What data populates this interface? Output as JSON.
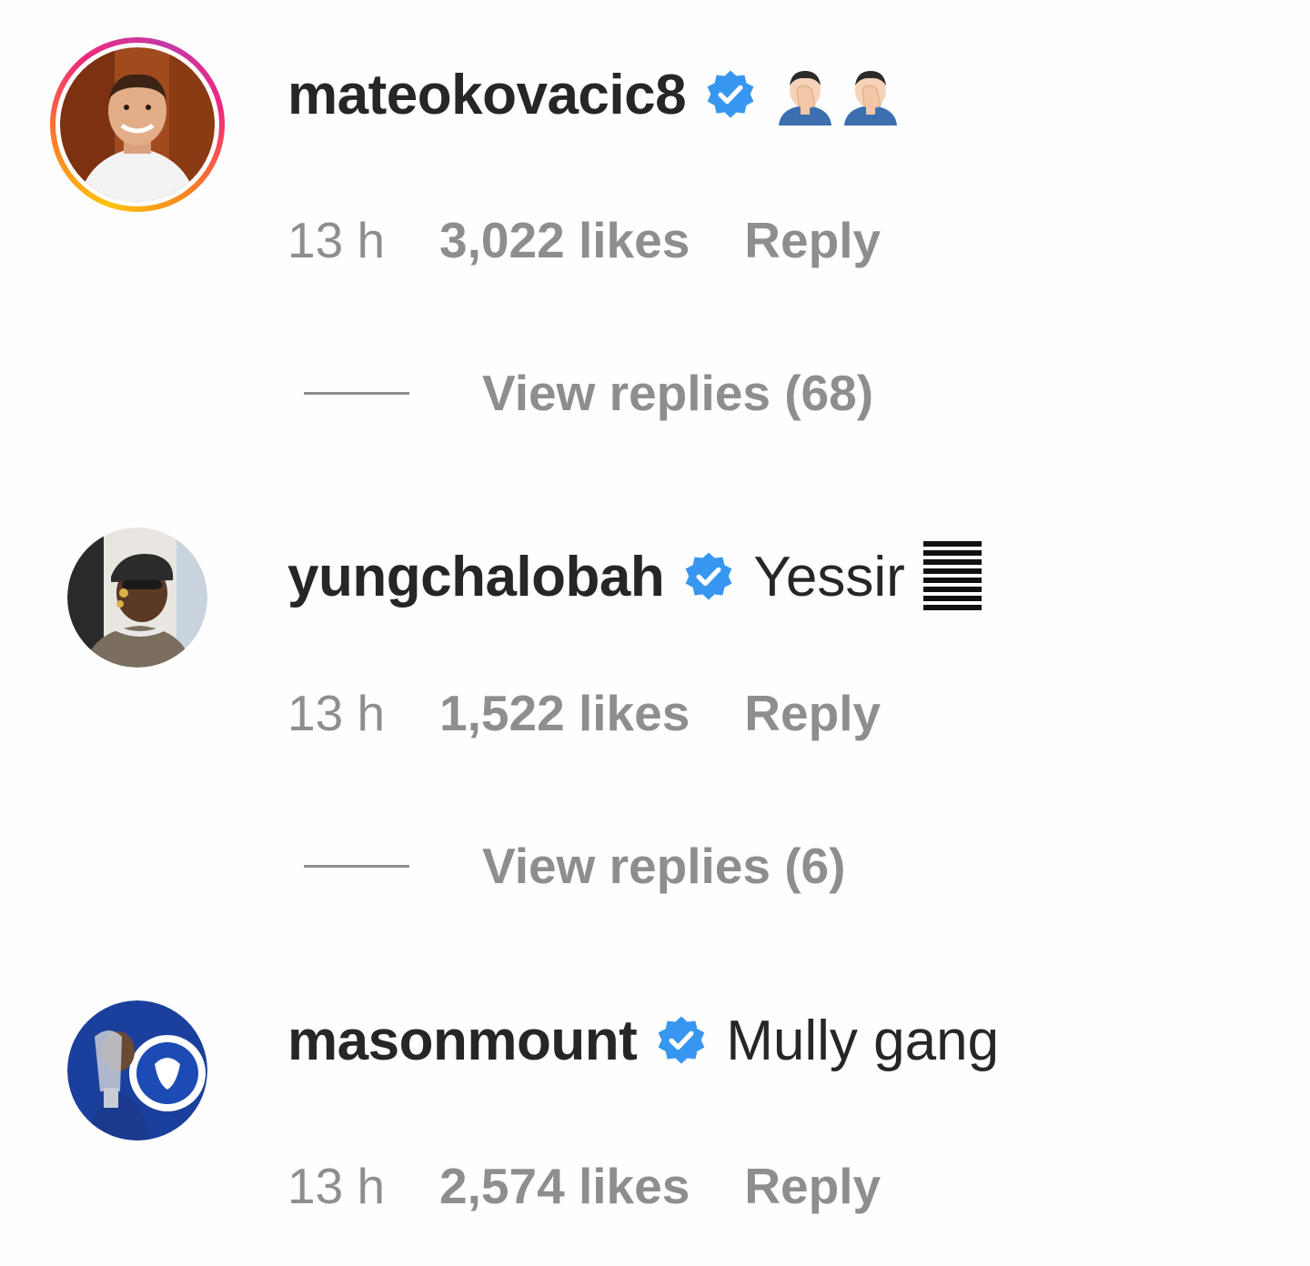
{
  "colors": {
    "username": "#262626",
    "meta": "#8e8e8e",
    "verified": "#3797f0",
    "background": "#fefefe"
  },
  "comments": [
    {
      "username": "mateokovacic8",
      "verified_icon": "verified-badge-icon",
      "text": "",
      "emoji": [
        "man-facepalming-emoji",
        "man-facepalming-emoji"
      ],
      "time": "13 h",
      "likes": "3,022 likes",
      "reply": "Reply",
      "view_replies": "View replies (68)",
      "has_story_ring": true
    },
    {
      "username": "yungchalobah",
      "verified_icon": "verified-badge-icon",
      "text": "Yessir",
      "emoji": [
        "bars-emoji"
      ],
      "time": "13 h",
      "likes": "1,522 likes",
      "reply": "Reply",
      "view_replies": "View replies (6)",
      "has_story_ring": false
    },
    {
      "username": "masonmount",
      "verified_icon": "verified-badge-icon",
      "text": "Mully gang",
      "emoji": [],
      "time": "13 h",
      "likes": "2,574 likes",
      "reply": "Reply",
      "has_story_ring": false
    }
  ]
}
